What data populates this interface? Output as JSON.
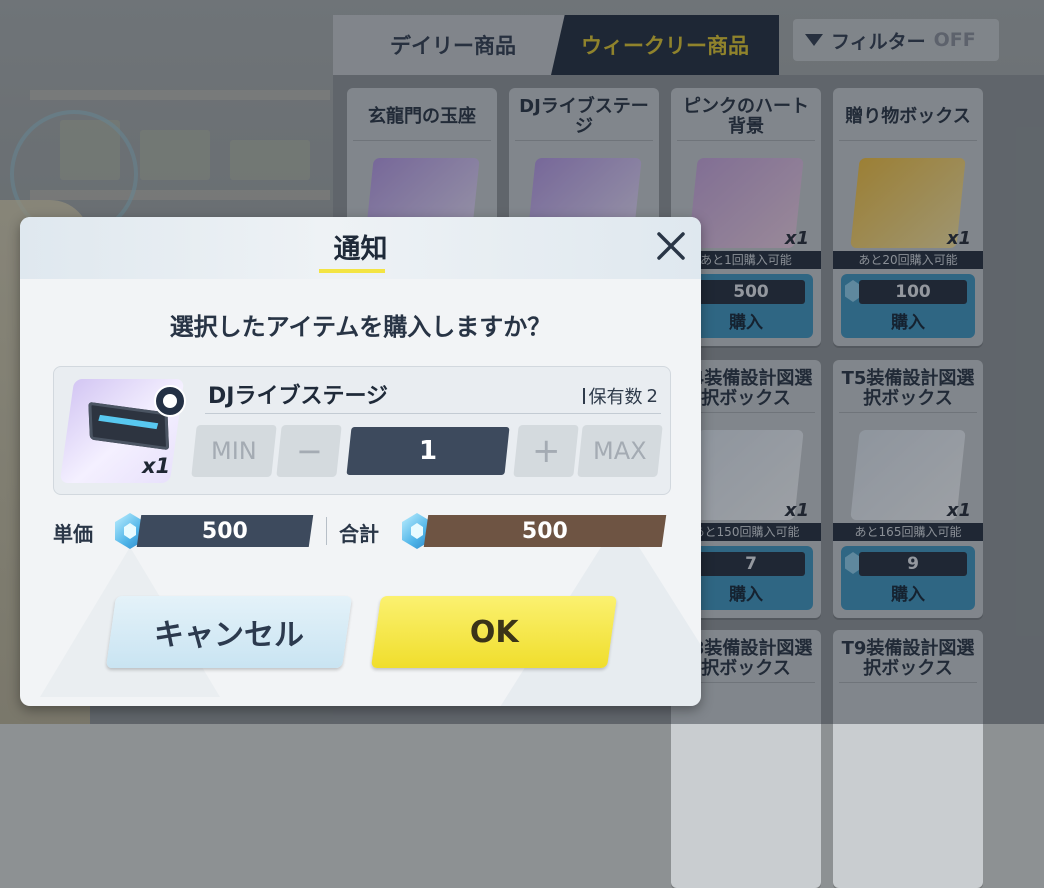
{
  "shop": {
    "tabs": [
      {
        "label": "デイリー商品",
        "active": false
      },
      {
        "label": "ウィークリー商品",
        "active": true
      }
    ],
    "filter": {
      "label": "フィルター",
      "state": "OFF"
    },
    "items": [
      {
        "title": "玄龍門の玉座",
        "qty": "",
        "remain": "",
        "price": "",
        "buy": ""
      },
      {
        "title": "DJライブステージ",
        "qty": "",
        "remain": "",
        "price": "",
        "buy": ""
      },
      {
        "title": "ピンクのハート背景",
        "qty": "x1",
        "remain": "あと1回購入可能",
        "price": "500",
        "buy": "購入"
      },
      {
        "title": "贈り物ボックス",
        "qty": "x1",
        "remain": "あと20回購入可能",
        "price": "100",
        "buy": "購入"
      },
      {
        "title": "T4装備設計図選択ボックス",
        "qty": "x1",
        "remain": "あと150回購入可能",
        "price": "7",
        "buy": "購入"
      },
      {
        "title": "T5装備設計図選択ボックス",
        "qty": "x1",
        "remain": "あと165回購入可能",
        "price": "9",
        "buy": "購入"
      },
      {
        "title": "T8装備設計図選択ボックス",
        "qty": "",
        "remain": "",
        "price": "",
        "buy": ""
      },
      {
        "title": "T9装備設計図選択ボックス",
        "qty": "",
        "remain": "",
        "price": "",
        "buy": ""
      }
    ]
  },
  "dialog": {
    "title": "通知",
    "question": "選択したアイテムを購入しますか？",
    "item": {
      "name": "DJライブステージ",
      "qty": "x1",
      "owned_label": "保有数",
      "owned_count": "2"
    },
    "quantity": {
      "min_label": "MIN",
      "minus_label": "−",
      "value": "1",
      "plus_label": "+",
      "max_label": "MAX"
    },
    "unit_price": {
      "label": "単価",
      "value": "500"
    },
    "total": {
      "label": "合計",
      "value": "500"
    },
    "cancel_label": "キャンセル",
    "ok_label": "OK"
  },
  "colors": {
    "accent_yellow": "#f3e443",
    "dark_navy": "#1f2a39",
    "total_brown": "#6e5443",
    "unit_slate": "#3d4a5d"
  },
  "icons": [
    "close-icon",
    "gem-icon",
    "filter-icon",
    "face-icon"
  ]
}
